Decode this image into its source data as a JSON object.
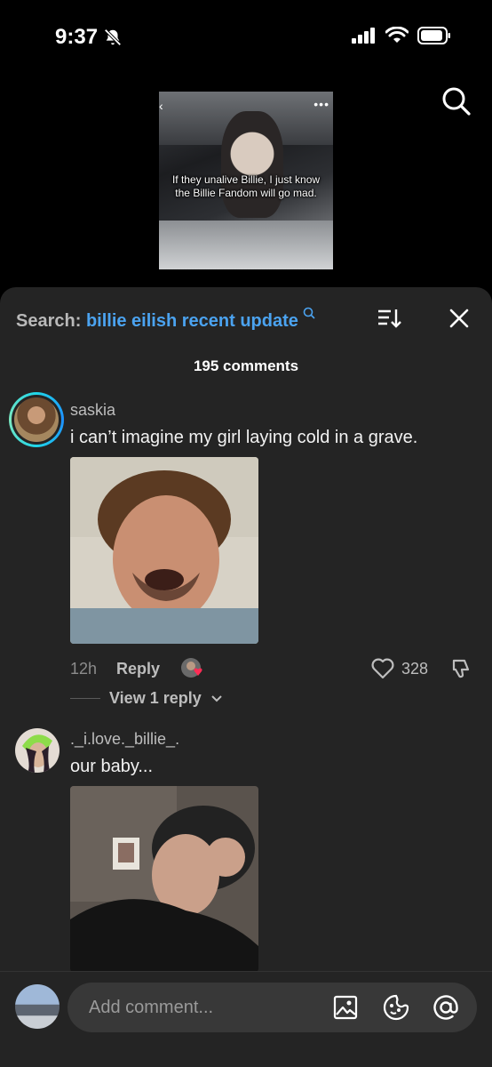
{
  "status_bar": {
    "time": "9:37"
  },
  "video": {
    "caption": "If they unalive Billie, I just know the Billie Fandom will go mad."
  },
  "sheet": {
    "search_prefix": "Search:",
    "search_query": "billie eilish recent update",
    "comment_count": "195 comments"
  },
  "comments": [
    {
      "username": "saskia",
      "text": "i can’t imagine my girl laying cold in a grave.",
      "age": "12h",
      "reply_label": "Reply",
      "likes": "328",
      "view_replies": "View 1 reply"
    },
    {
      "username": "._i.love._billie_.",
      "text": "our baby..."
    }
  ],
  "composer": {
    "placeholder": "Add comment..."
  }
}
